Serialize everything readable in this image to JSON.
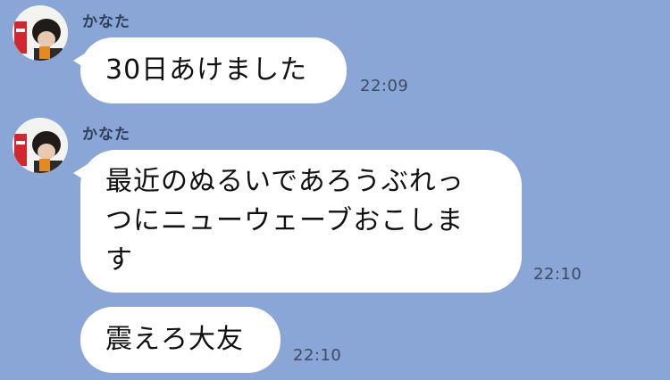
{
  "chat": {
    "messages": [
      {
        "sender": "かなた",
        "text": "30日あけました",
        "time": "22:09"
      },
      {
        "sender": "かなた",
        "text": "最近のぬるいであろうぶれっ\nつにニューウェーブおこしま\nす",
        "time": "22:10"
      },
      {
        "text": "震えろ大友",
        "time": "22:10"
      }
    ]
  },
  "colors": {
    "background": "#8aa6d6",
    "bubble": "#ffffff",
    "time_text": "#3c4a63"
  }
}
